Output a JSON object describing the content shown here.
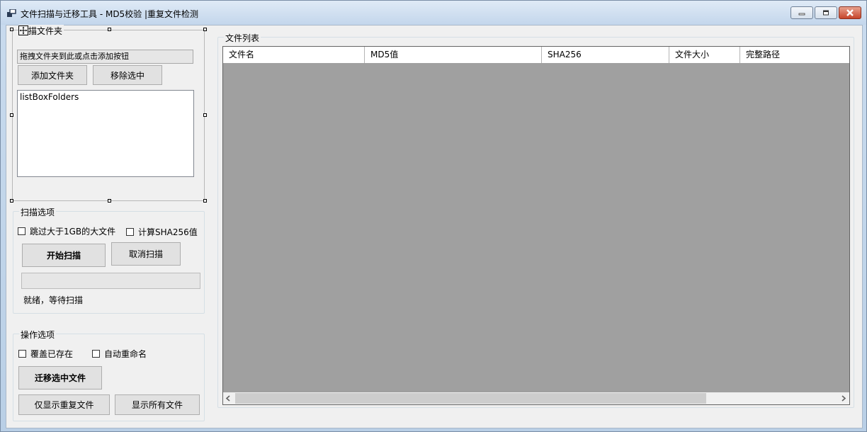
{
  "window": {
    "title": "文件扫描与迁移工具 - MD5校验 |重复文件检测",
    "controls": {
      "minimize_icon": "minimize-icon",
      "maximize_icon": "maximize-icon",
      "close_icon": "close-icon"
    }
  },
  "scan_folder": {
    "group_title": "扫描文件夹",
    "drop_hint": "拖拽文件夹到此或点击添加按钮",
    "add_button": "添加文件夹",
    "remove_button": "移除选中",
    "listbox_text": "listBoxFolders"
  },
  "scan_options": {
    "group_title": "扫描选项",
    "skip_large_label": "跳过大于1GB的大文件",
    "skip_large_checked": false,
    "sha256_label": "计算SHA256值",
    "sha256_checked": false,
    "start_button": "开始扫描",
    "cancel_button": "取消扫描",
    "progress": 0,
    "status_text": "就绪，等待扫描"
  },
  "operation_options": {
    "group_title": "操作选项",
    "overwrite_label": "覆盖已存在",
    "overwrite_checked": false,
    "auto_rename_label": "自动重命名",
    "auto_rename_checked": false,
    "migrate_button": "迁移选中文件",
    "show_duplicates_button": "仅显示重复文件",
    "show_all_button": "显示所有文件"
  },
  "file_list": {
    "group_title": "文件列表",
    "columns": [
      "文件名",
      "MD5值",
      "SHA256",
      "文件大小",
      "完整路径"
    ],
    "rows": []
  },
  "colors": {
    "grid_background": "#a0a0a0",
    "form_background": "#f0f0f0",
    "title_bar": "#c3d6ec"
  }
}
